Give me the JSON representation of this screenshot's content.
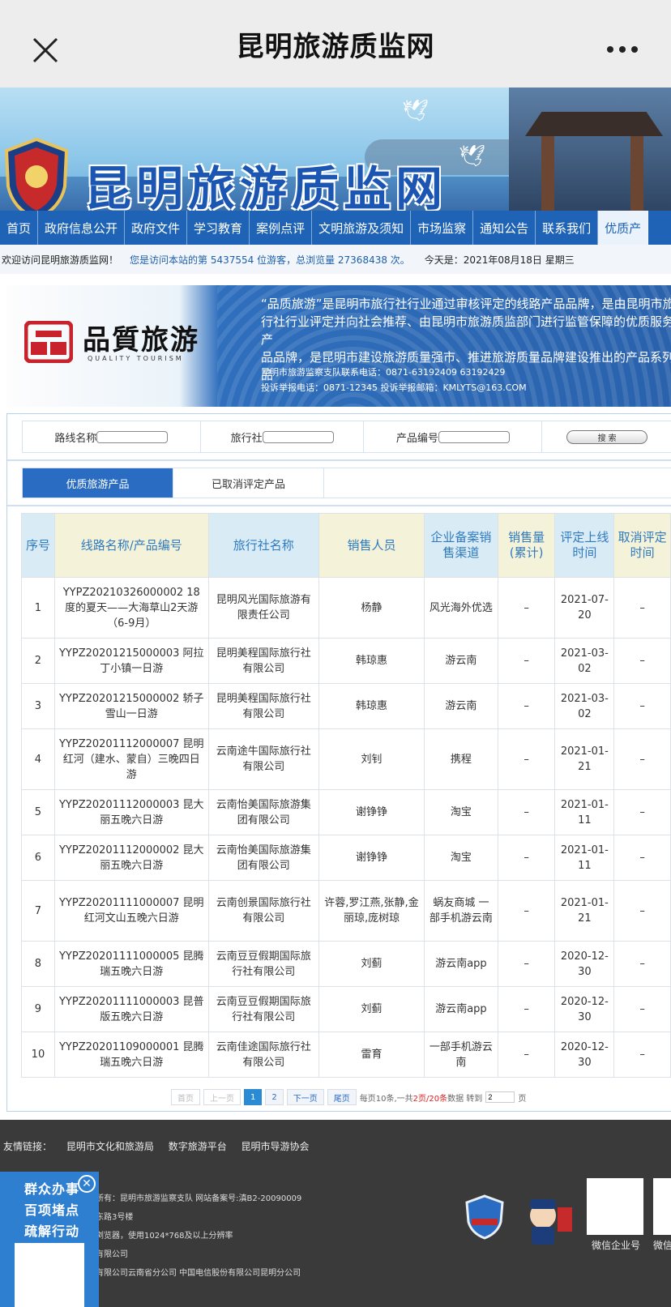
{
  "topbar": {
    "title": "昆明旅游质监网"
  },
  "banner": {
    "site_name": "昆明旅游质监网"
  },
  "menu": [
    {
      "label": "首页"
    },
    {
      "label": "政府信息公开"
    },
    {
      "label": "政府文件"
    },
    {
      "label": "学习教育"
    },
    {
      "label": "案例点评"
    },
    {
      "label": "文明旅游及须知"
    },
    {
      "label": "市场监察"
    },
    {
      "label": "通知公告"
    },
    {
      "label": "联系我们"
    },
    {
      "label": "优质产"
    }
  ],
  "welcome": {
    "greeting": "欢迎访问昆明旅游质监网！",
    "visits": "您是访问本站的第 5437554 位游客，总浏览量 27368438 次。",
    "today": "今天是：2021年08月18日 星期三"
  },
  "quality_banner": {
    "logo_text": "品質旅游",
    "logo_sub": "QUALITY TOURISM",
    "desc_lines": [
      "“品质旅游”是昆明市旅行社行业通过审核评定的线路产品品牌，是由昆明市旅",
      "行社行业评定并向社会推荐、由昆明市旅游质监部门进行监管保障的优质服务产",
      "品品牌，是昆明市建设旅游质量强市、推进旅游质量品牌建设推出的产品系列品"
    ],
    "contact_phone": "昆明市旅游监察支队联系电话：0871-63192409  63192429",
    "complaint": "投诉举报电话：0871-12345  投诉举报邮箱：KMLYTS@163.COM"
  },
  "search": {
    "route_label": "路线名称",
    "agency_label": "旅行社",
    "code_label": "产品编号",
    "button": "搜 索"
  },
  "tabs": [
    {
      "label": "优质旅游产品"
    },
    {
      "label": "已取消评定产品"
    }
  ],
  "table": {
    "headers": [
      "序号",
      "线路名称/产品编号",
      "旅行社名称",
      "销售人员",
      "企业备案销售渠道",
      "销售量(累计)",
      "评定上线时间",
      "取消评定时间"
    ],
    "rows": [
      {
        "no": "1",
        "route": "YYPZ20210326000002 18度的夏天——大海草山2天游（6-9月）",
        "agency": "昆明风光国际旅游有限责任公司",
        "sales": "杨静",
        "channel": "风光海外优选",
        "volume": "–",
        "online": "2021-07-20",
        "cancel": "–"
      },
      {
        "no": "2",
        "route": "YYPZ20201215000003 阿拉丁小镇一日游",
        "agency": "昆明美程国际旅行社有限公司",
        "sales": "韩琼惠",
        "channel": "游云南",
        "volume": "–",
        "online": "2021-03-02",
        "cancel": "–"
      },
      {
        "no": "3",
        "route": "YYPZ20201215000002 轿子雪山一日游",
        "agency": "昆明美程国际旅行社有限公司",
        "sales": "韩琼惠",
        "channel": "游云南",
        "volume": "–",
        "online": "2021-03-02",
        "cancel": "–"
      },
      {
        "no": "4",
        "route": "YYPZ20201112000007 昆明红河（建水、蒙自）三晚四日游",
        "agency": "云南途牛国际旅行社有限公司",
        "sales": "刘钊",
        "channel": "携程",
        "volume": "–",
        "online": "2021-01-21",
        "cancel": "–"
      },
      {
        "no": "5",
        "route": "YYPZ20201112000003 昆大丽五晚六日游",
        "agency": "云南怡美国际旅游集团有限公司",
        "sales": "谢铮铮",
        "channel": "淘宝",
        "volume": "–",
        "online": "2021-01-11",
        "cancel": "–"
      },
      {
        "no": "6",
        "route": "YYPZ20201112000002 昆大丽五晚六日游",
        "agency": "云南怡美国际旅游集团有限公司",
        "sales": "谢铮铮",
        "channel": "淘宝",
        "volume": "–",
        "online": "2021-01-11",
        "cancel": "–"
      },
      {
        "no": "7",
        "route": "YYPZ20201111000007 昆明红河文山五晚六日游",
        "agency": "云南创景国际旅行社有限公司",
        "sales": "许蓉,罗江燕,张静,金丽琼,庞树琼",
        "channel": "蜗友商城 一部手机游云南",
        "volume": "–",
        "online": "2021-01-21",
        "cancel": "–"
      },
      {
        "no": "8",
        "route": "YYPZ20201111000005 昆腾瑞五晚六日游",
        "agency": "云南豆豆假期国际旅行社有限公司",
        "sales": "刘蓟",
        "channel": "游云南app",
        "volume": "–",
        "online": "2020-12-30",
        "cancel": "–"
      },
      {
        "no": "9",
        "route": "YYPZ20201111000003 昆普版五晚六日游",
        "agency": "云南豆豆假期国际旅行社有限公司",
        "sales": "刘蓟",
        "channel": "游云南app",
        "volume": "–",
        "online": "2020-12-30",
        "cancel": "–"
      },
      {
        "no": "10",
        "route": "YYPZ20201109000001 昆腾瑞五晚六日游",
        "agency": "云南佳途国际旅行社有限公司",
        "sales": "雷育",
        "channel": "一部手机游云南",
        "volume": "–",
        "online": "2020-12-30",
        "cancel": "–"
      }
    ]
  },
  "pager": {
    "first": "首页",
    "prev": "上一页",
    "p1": "1",
    "p2": "2",
    "next": "下一页",
    "last": "尾页",
    "info_a": "每页10条,一共 ",
    "info_b": "2页/20条",
    "info_c": " 数据  转到",
    "goto_value": "2",
    "page_unit": "页"
  },
  "footer": {
    "links_label": "友情链接：",
    "links": [
      "昆明市文化和旅游局",
      "数字旅游平台",
      "昆明市导游协会"
    ],
    "info": [
      "所有：昆明市旅游监察支队     网站备案号:滇B2-20090009",
      "东路3号楼",
      "浏览器，使用1024*768及以上分辨率",
      "有限公司",
      "有限公司云南省分公司  中国电信股份有限公司昆明分公司"
    ],
    "qr1_label": "微信企业号",
    "qr2_label": "微信"
  },
  "float_ad": {
    "line1": "群众办事",
    "line2": "百项堵点",
    "line3": "疏解行动"
  }
}
